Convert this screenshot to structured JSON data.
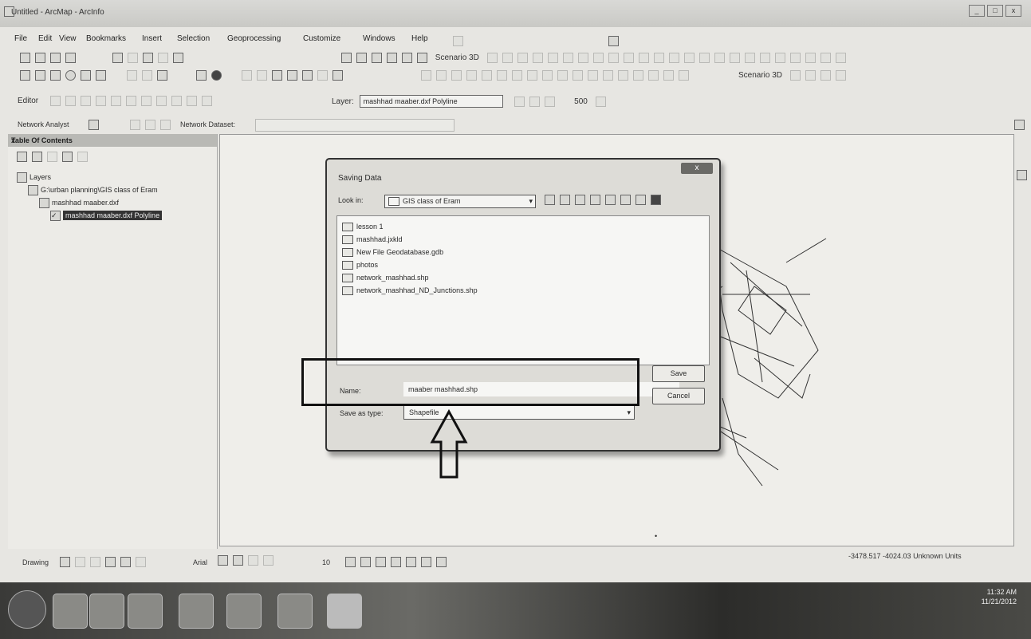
{
  "window": {
    "title": "Untitled - ArcMap - ArcInfo",
    "buttons": [
      "_",
      "□",
      "x"
    ]
  },
  "menu": [
    "File",
    "Edit",
    "View",
    "Bookmarks",
    "Insert",
    "Selection",
    "Geoprocessing",
    "Customize",
    "Windows",
    "Help"
  ],
  "toolbars": {
    "scene_3d": "Scenario 3D",
    "scene_3d_b": "Scenario 3D",
    "editor": "Editor",
    "layer_label": "Layer:",
    "layer_value": "mashhad maaber.dxf Polyline",
    "scale_value": "500",
    "network_analyst": "Network Analyst",
    "network_dataset": "Network Dataset:"
  },
  "toc": {
    "title": "Table Of Contents",
    "close": "x",
    "items": [
      {
        "text": "Layers"
      },
      {
        "text": "G:\\urban planning\\GIS class of Eram"
      },
      {
        "text": "mashhad maaber.dxf"
      },
      {
        "text": "mashhad maaber.dxf Polyline"
      }
    ]
  },
  "dialog": {
    "title": "Saving Data",
    "close": "x",
    "look_in_label": "Look in:",
    "look_in_value": "GIS class of Eram",
    "files": [
      "lesson 1",
      "mashhad.jxkld",
      "New File Geodatabase.gdb",
      "photos",
      "network_mashhad.shp",
      "network_mashhad_ND_Junctions.shp"
    ],
    "name_label": "Name:",
    "name_value": "maaber mashhad.shp",
    "type_label": "Save as type:",
    "type_value": "Shapefile",
    "save_button": "Save",
    "cancel_button": "Cancel"
  },
  "status": {
    "coords": "-3478.517  -4024.03 Unknown Units"
  },
  "drawing": {
    "label": "Drawing",
    "font_size": "10",
    "font": "Arial"
  },
  "taskbar": {
    "time": "11:32 AM",
    "date": "11/21/2012"
  }
}
